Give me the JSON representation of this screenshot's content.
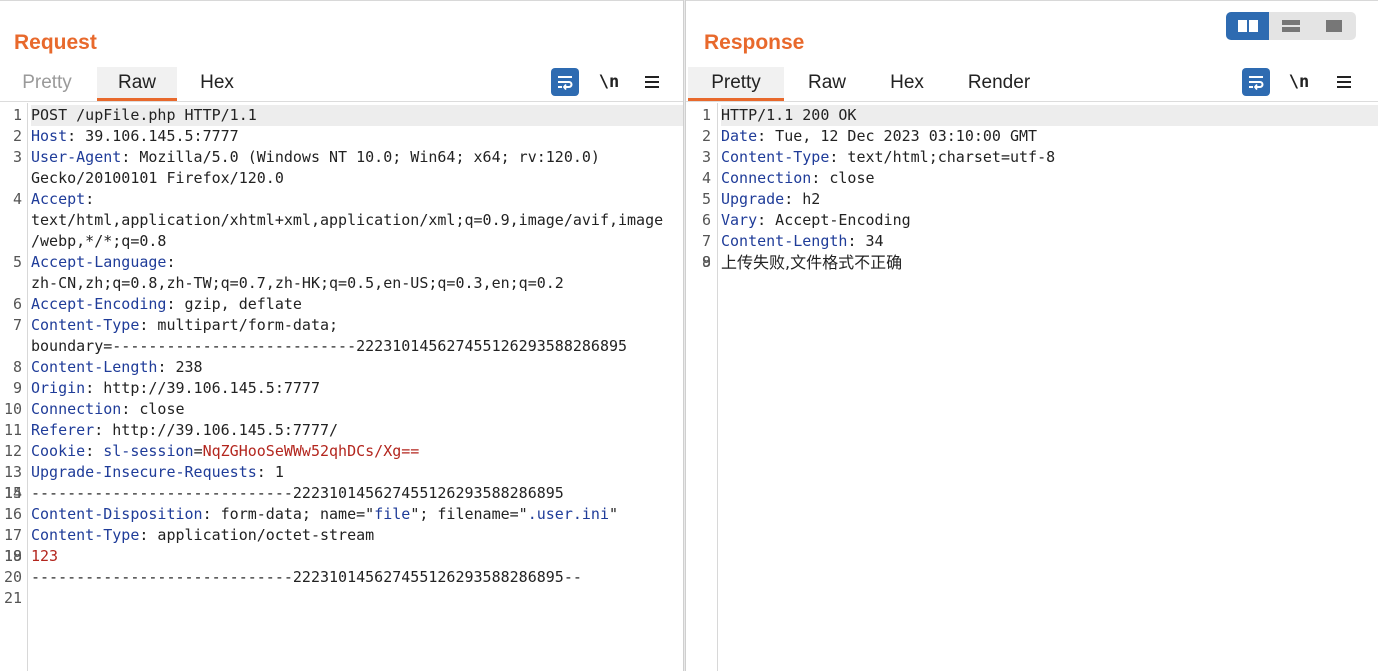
{
  "request": {
    "title": "Request",
    "tabs": [
      "Pretty",
      "Raw",
      "Hex"
    ],
    "active_tab": "Raw",
    "tools": {
      "wrap_icon": "wrap-lines-icon",
      "newline_label": "\\n",
      "menu_icon": "hamburger-menu-icon"
    },
    "lines": [
      {
        "n": "1",
        "segs": [
          {
            "t": "POST /upFile.php HTTP/1.1"
          }
        ],
        "hl": true
      },
      {
        "n": "2",
        "segs": [
          {
            "t": "Host",
            "c": "k"
          },
          {
            "t": ": 39.106.145.5:7777"
          }
        ]
      },
      {
        "n": "3",
        "segs": [
          {
            "t": "User-Agent",
            "c": "k"
          },
          {
            "t": ": Mozilla/5.0 (Windows NT 10.0; Win64; x64; rv:120.0)"
          }
        ]
      },
      {
        "n": "",
        "segs": [
          {
            "t": "Gecko/20100101 Firefox/120.0"
          }
        ]
      },
      {
        "n": "4",
        "segs": [
          {
            "t": "Accept",
            "c": "k"
          },
          {
            "t": ":"
          }
        ]
      },
      {
        "n": "",
        "segs": [
          {
            "t": "text/html,application/xhtml+xml,application/xml;q=0.9,image/avif,image"
          }
        ]
      },
      {
        "n": "",
        "segs": [
          {
            "t": "/webp,*/*;q=0.8"
          }
        ]
      },
      {
        "n": "5",
        "segs": [
          {
            "t": "Accept-Language",
            "c": "k"
          },
          {
            "t": ":"
          }
        ]
      },
      {
        "n": "",
        "segs": [
          {
            "t": "zh-CN,zh;q=0.8,zh-TW;q=0.7,zh-HK;q=0.5,en-US;q=0.3,en;q=0.2"
          }
        ]
      },
      {
        "n": "6",
        "segs": [
          {
            "t": "Accept-Encoding",
            "c": "k"
          },
          {
            "t": ": gzip, deflate"
          }
        ]
      },
      {
        "n": "7",
        "segs": [
          {
            "t": "Content-Type",
            "c": "k"
          },
          {
            "t": ": multipart/form-data;"
          }
        ]
      },
      {
        "n": "",
        "segs": [
          {
            "t": "boundary=---------------------------22231014562745512629358828689 5"
          }
        ]
      },
      {
        "n": "8",
        "segs": [
          {
            "t": "Content-Length",
            "c": "k"
          },
          {
            "t": ": 238"
          }
        ]
      },
      {
        "n": "9",
        "segs": [
          {
            "t": "Origin",
            "c": "k"
          },
          {
            "t": ": http://39.106.145.5:7777"
          }
        ]
      },
      {
        "n": "10",
        "segs": [
          {
            "t": "Connection",
            "c": "k"
          },
          {
            "t": ": close"
          }
        ]
      },
      {
        "n": "11",
        "segs": [
          {
            "t": "Referer",
            "c": "k"
          },
          {
            "t": ": http://39.106.145.5:7777/"
          }
        ]
      },
      {
        "n": "12",
        "segs": [
          {
            "t": "Cookie",
            "c": "k"
          },
          {
            "t": ": "
          },
          {
            "t": "sl-session",
            "c": "k"
          },
          {
            "t": "="
          },
          {
            "t": "NqZGHooSeWWw52qhDCs/Xg==",
            "c": "r"
          }
        ]
      },
      {
        "n": "13",
        "segs": [
          {
            "t": "Upgrade-Insecure-Requests",
            "c": "k"
          },
          {
            "t": ": 1"
          }
        ]
      },
      {
        "n": "14",
        "segs": [
          {
            "t": ""
          }
        ]
      },
      {
        "n": "15",
        "segs": [
          {
            "t": "-----------------------------222310145627455126293588286895"
          }
        ]
      },
      {
        "n": "16",
        "segs": [
          {
            "t": "Content-Disposition",
            "c": "k"
          },
          {
            "t": ": form-data; name=\""
          },
          {
            "t": "file",
            "c": "k"
          },
          {
            "t": "\"; filename=\""
          },
          {
            "t": ".user.ini",
            "c": "k"
          },
          {
            "t": "\""
          }
        ]
      },
      {
        "n": "17",
        "segs": [
          {
            "t": "Content-Type",
            "c": "k"
          },
          {
            "t": ": application/octet-stream"
          }
        ]
      },
      {
        "n": "18",
        "segs": [
          {
            "t": ""
          }
        ]
      },
      {
        "n": "19",
        "segs": [
          {
            "t": "123",
            "c": "r"
          }
        ]
      },
      {
        "n": "20",
        "segs": [
          {
            "t": "-----------------------------222310145627455126293588286895--"
          }
        ]
      },
      {
        "n": "21",
        "segs": [
          {
            "t": ""
          }
        ]
      }
    ]
  },
  "response": {
    "title": "Response",
    "tabs": [
      "Pretty",
      "Raw",
      "Hex",
      "Render"
    ],
    "active_tab": "Pretty",
    "tools": {
      "wrap_icon": "wrap-lines-icon",
      "newline_label": "\\n",
      "menu_icon": "hamburger-menu-icon"
    },
    "lines": [
      {
        "n": "1",
        "segs": [
          {
            "t": "HTTP/1.1 200 OK"
          }
        ],
        "hl": true
      },
      {
        "n": "2",
        "segs": [
          {
            "t": "Date",
            "c": "k"
          },
          {
            "t": ": Tue, 12 Dec 2023 03:10:00 GMT"
          }
        ]
      },
      {
        "n": "3",
        "segs": [
          {
            "t": "Content-Type",
            "c": "k"
          },
          {
            "t": ": text/html;charset=utf-8"
          }
        ]
      },
      {
        "n": "4",
        "segs": [
          {
            "t": "Connection",
            "c": "k"
          },
          {
            "t": ": close"
          }
        ]
      },
      {
        "n": "5",
        "segs": [
          {
            "t": "Upgrade",
            "c": "k"
          },
          {
            "t": ": h2"
          }
        ]
      },
      {
        "n": "6",
        "segs": [
          {
            "t": "Vary",
            "c": "k"
          },
          {
            "t": ": Accept-Encoding"
          }
        ]
      },
      {
        "n": "7",
        "segs": [
          {
            "t": "Content-Length",
            "c": "k"
          },
          {
            "t": ": 34"
          }
        ]
      },
      {
        "n": "8",
        "segs": [
          {
            "t": ""
          }
        ]
      },
      {
        "n": "9",
        "segs": [
          {
            "t": "上传失败,文件格式不正确",
            "cjk": true
          }
        ]
      }
    ]
  },
  "view_switch": {
    "buttons": [
      "side-by-side-layout-icon",
      "top-bottom-layout-icon",
      "single-pane-layout-icon"
    ],
    "active": 0
  },
  "colors": {
    "accent": "#e8692c",
    "key": "#1f3c99",
    "value_red": "#b3261e",
    "button_blue": "#2e6bb1"
  }
}
